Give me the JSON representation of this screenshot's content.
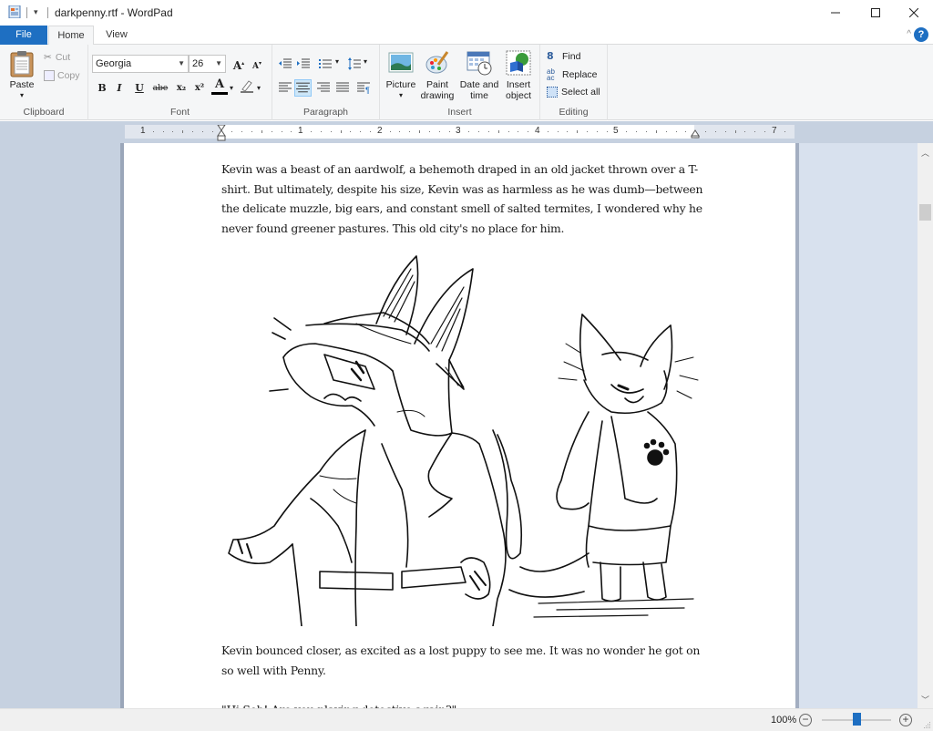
{
  "window": {
    "title": "darkpenny.rtf - WordPad",
    "quick_access_arrow": "▾",
    "controls": {
      "minimize": "minimize",
      "maximize": "maximize",
      "close": "close"
    }
  },
  "tabs": [
    {
      "label": "File"
    },
    {
      "label": "Home",
      "active": true
    },
    {
      "label": "View"
    }
  ],
  "ribbon": {
    "collapse_glyph": "^",
    "help_glyph": "?",
    "clipboard": {
      "label": "Clipboard",
      "paste": "Paste",
      "cut": "Cut",
      "copy": "Copy"
    },
    "font": {
      "label": "Font",
      "family": "Georgia",
      "size": "26",
      "grow": "A",
      "shrink": "A",
      "bold": "B",
      "italic": "I",
      "underline": "U",
      "strikethrough": "abe",
      "subscript": "x₂",
      "superscript": "x²",
      "text_color_glyph": "A"
    },
    "paragraph": {
      "label": "Paragraph",
      "active_alignment": "center"
    },
    "insert": {
      "label": "Insert",
      "picture": "Picture",
      "paint_drawing_1": "Paint",
      "paint_drawing_2": "drawing",
      "date_time_1": "Date and",
      "date_time_2": "time",
      "insert_object_1": "Insert",
      "insert_object_2": "object"
    },
    "editing": {
      "label": "Editing",
      "find": "Find",
      "replace": "Replace",
      "select_all": "Select all"
    }
  },
  "ruler": {
    "labels": [
      "1",
      "1",
      "2",
      "3",
      "4",
      "5",
      "7"
    ]
  },
  "document": {
    "paragraphs": [
      "Kevin was a beast of an aardwolf, a behemoth draped in an old jacket thrown over a T-shirt. But ultimately, despite his size, Kevin was as harmless as he was dumb—between the delicate muzzle, big ears, and constant smell of salted termites, I wondered why he never found greener pastures. This old city's no place for him.",
      "Kevin bounced closer, as excited as a lost puppy to see me. It was no wonder he got on so well with Penny.",
      "\"Hi Seb! Are you playing detective again?\""
    ],
    "image_alt": "Sketch of an aardwolf in a hat and trench coat beside a smaller smiling fox-like character in a jacket"
  },
  "status": {
    "zoom": "100%",
    "zoom_slider_fraction": 0.5,
    "zoom_out_glyph": "−",
    "zoom_in_glyph": "+"
  }
}
